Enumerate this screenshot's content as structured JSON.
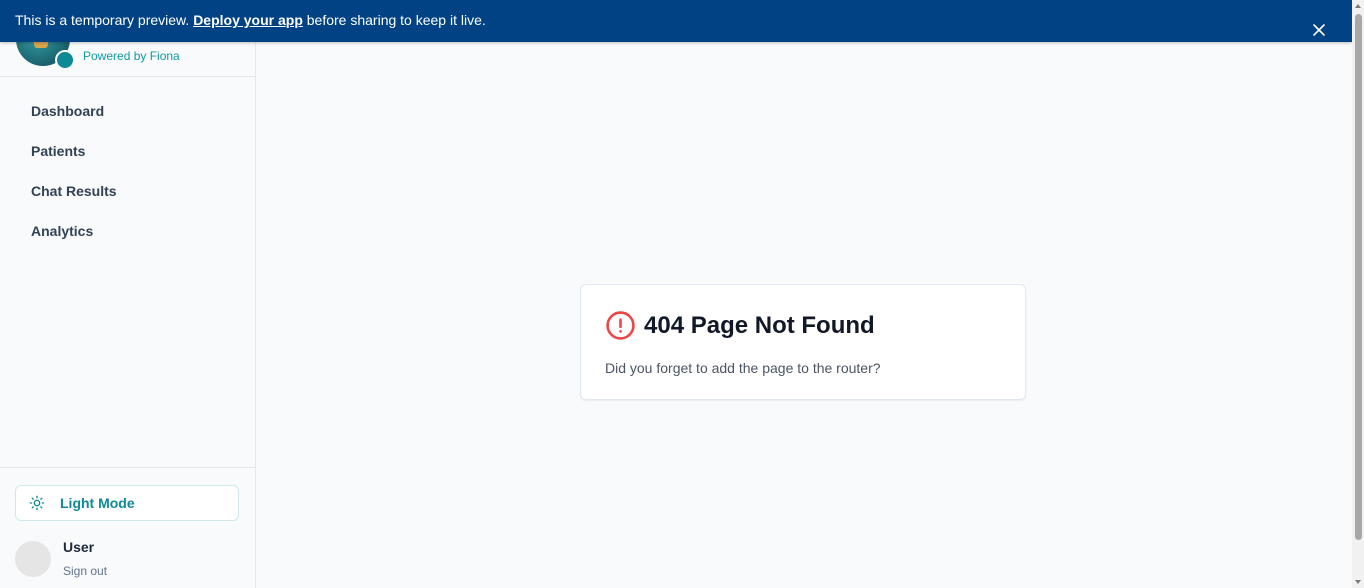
{
  "banner": {
    "prefix": "This is a temporary preview.",
    "link": "Deploy your app",
    "suffix": "before sharing to keep it live."
  },
  "brand": {
    "subtitle": "Powered by Fiona"
  },
  "sidebar": {
    "items": [
      {
        "label": "Dashboard"
      },
      {
        "label": "Patients"
      },
      {
        "label": "Chat Results"
      },
      {
        "label": "Analytics"
      }
    ],
    "mode_label": "Light Mode",
    "user_name": "User",
    "sign_out": "Sign out"
  },
  "main": {
    "error_title": "404 Page Not Found",
    "error_text": "Did you forget to add the page to the router?"
  },
  "colors": {
    "banner": "#004283",
    "accent": "#0e8a95",
    "error": "#ef4444"
  }
}
